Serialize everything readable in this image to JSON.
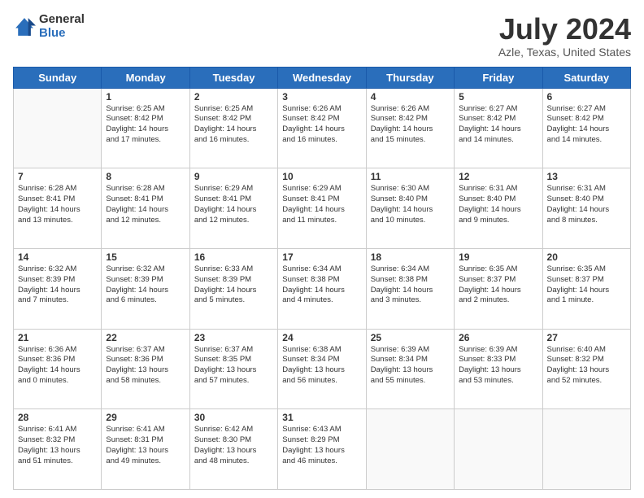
{
  "header": {
    "logo_general": "General",
    "logo_blue": "Blue",
    "month_title": "July 2024",
    "location": "Azle, Texas, United States"
  },
  "days_of_week": [
    "Sunday",
    "Monday",
    "Tuesday",
    "Wednesday",
    "Thursday",
    "Friday",
    "Saturday"
  ],
  "weeks": [
    [
      {
        "day": "",
        "info": ""
      },
      {
        "day": "1",
        "info": "Sunrise: 6:25 AM\nSunset: 8:42 PM\nDaylight: 14 hours\nand 17 minutes."
      },
      {
        "day": "2",
        "info": "Sunrise: 6:25 AM\nSunset: 8:42 PM\nDaylight: 14 hours\nand 16 minutes."
      },
      {
        "day": "3",
        "info": "Sunrise: 6:26 AM\nSunset: 8:42 PM\nDaylight: 14 hours\nand 16 minutes."
      },
      {
        "day": "4",
        "info": "Sunrise: 6:26 AM\nSunset: 8:42 PM\nDaylight: 14 hours\nand 15 minutes."
      },
      {
        "day": "5",
        "info": "Sunrise: 6:27 AM\nSunset: 8:42 PM\nDaylight: 14 hours\nand 14 minutes."
      },
      {
        "day": "6",
        "info": "Sunrise: 6:27 AM\nSunset: 8:42 PM\nDaylight: 14 hours\nand 14 minutes."
      }
    ],
    [
      {
        "day": "7",
        "info": "Sunrise: 6:28 AM\nSunset: 8:41 PM\nDaylight: 14 hours\nand 13 minutes."
      },
      {
        "day": "8",
        "info": "Sunrise: 6:28 AM\nSunset: 8:41 PM\nDaylight: 14 hours\nand 12 minutes."
      },
      {
        "day": "9",
        "info": "Sunrise: 6:29 AM\nSunset: 8:41 PM\nDaylight: 14 hours\nand 12 minutes."
      },
      {
        "day": "10",
        "info": "Sunrise: 6:29 AM\nSunset: 8:41 PM\nDaylight: 14 hours\nand 11 minutes."
      },
      {
        "day": "11",
        "info": "Sunrise: 6:30 AM\nSunset: 8:40 PM\nDaylight: 14 hours\nand 10 minutes."
      },
      {
        "day": "12",
        "info": "Sunrise: 6:31 AM\nSunset: 8:40 PM\nDaylight: 14 hours\nand 9 minutes."
      },
      {
        "day": "13",
        "info": "Sunrise: 6:31 AM\nSunset: 8:40 PM\nDaylight: 14 hours\nand 8 minutes."
      }
    ],
    [
      {
        "day": "14",
        "info": "Sunrise: 6:32 AM\nSunset: 8:39 PM\nDaylight: 14 hours\nand 7 minutes."
      },
      {
        "day": "15",
        "info": "Sunrise: 6:32 AM\nSunset: 8:39 PM\nDaylight: 14 hours\nand 6 minutes."
      },
      {
        "day": "16",
        "info": "Sunrise: 6:33 AM\nSunset: 8:39 PM\nDaylight: 14 hours\nand 5 minutes."
      },
      {
        "day": "17",
        "info": "Sunrise: 6:34 AM\nSunset: 8:38 PM\nDaylight: 14 hours\nand 4 minutes."
      },
      {
        "day": "18",
        "info": "Sunrise: 6:34 AM\nSunset: 8:38 PM\nDaylight: 14 hours\nand 3 minutes."
      },
      {
        "day": "19",
        "info": "Sunrise: 6:35 AM\nSunset: 8:37 PM\nDaylight: 14 hours\nand 2 minutes."
      },
      {
        "day": "20",
        "info": "Sunrise: 6:35 AM\nSunset: 8:37 PM\nDaylight: 14 hours\nand 1 minute."
      }
    ],
    [
      {
        "day": "21",
        "info": "Sunrise: 6:36 AM\nSunset: 8:36 PM\nDaylight: 14 hours\nand 0 minutes."
      },
      {
        "day": "22",
        "info": "Sunrise: 6:37 AM\nSunset: 8:36 PM\nDaylight: 13 hours\nand 58 minutes."
      },
      {
        "day": "23",
        "info": "Sunrise: 6:37 AM\nSunset: 8:35 PM\nDaylight: 13 hours\nand 57 minutes."
      },
      {
        "day": "24",
        "info": "Sunrise: 6:38 AM\nSunset: 8:34 PM\nDaylight: 13 hours\nand 56 minutes."
      },
      {
        "day": "25",
        "info": "Sunrise: 6:39 AM\nSunset: 8:34 PM\nDaylight: 13 hours\nand 55 minutes."
      },
      {
        "day": "26",
        "info": "Sunrise: 6:39 AM\nSunset: 8:33 PM\nDaylight: 13 hours\nand 53 minutes."
      },
      {
        "day": "27",
        "info": "Sunrise: 6:40 AM\nSunset: 8:32 PM\nDaylight: 13 hours\nand 52 minutes."
      }
    ],
    [
      {
        "day": "28",
        "info": "Sunrise: 6:41 AM\nSunset: 8:32 PM\nDaylight: 13 hours\nand 51 minutes."
      },
      {
        "day": "29",
        "info": "Sunrise: 6:41 AM\nSunset: 8:31 PM\nDaylight: 13 hours\nand 49 minutes."
      },
      {
        "day": "30",
        "info": "Sunrise: 6:42 AM\nSunset: 8:30 PM\nDaylight: 13 hours\nand 48 minutes."
      },
      {
        "day": "31",
        "info": "Sunrise: 6:43 AM\nSunset: 8:29 PM\nDaylight: 13 hours\nand 46 minutes."
      },
      {
        "day": "",
        "info": ""
      },
      {
        "day": "",
        "info": ""
      },
      {
        "day": "",
        "info": ""
      }
    ]
  ]
}
